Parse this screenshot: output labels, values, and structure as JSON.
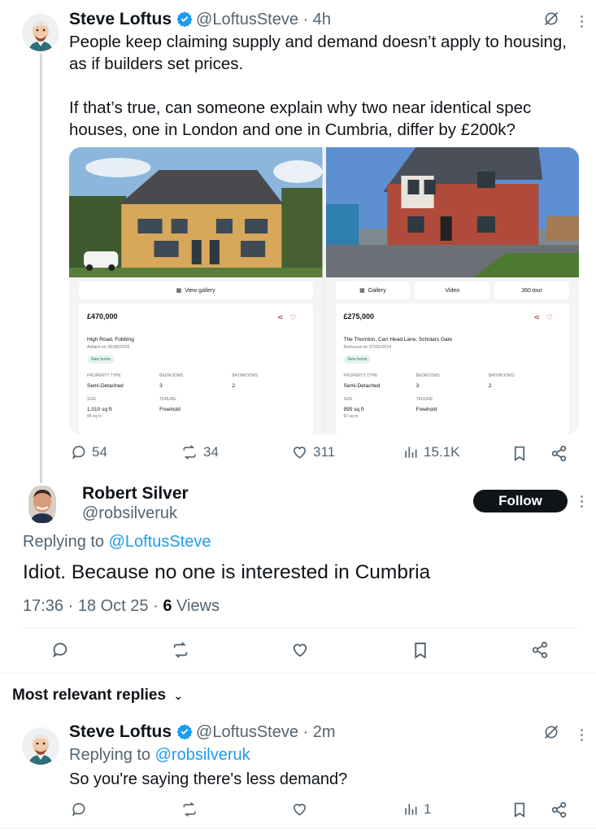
{
  "colors": {
    "accent": "#1d9bf0",
    "text": "#0f1419",
    "muted": "#536471",
    "follow_bg": "#0f1419"
  },
  "post": {
    "author_name": "Steve Loftus",
    "handle_time": "@LoftusSteve · 4h",
    "text_line1": "People keep claiming supply and demand doesn’t apply to housing,",
    "text_line2": "as if builders set prices.",
    "text_line3": "If that’s true, can someone explain why two near identical spec",
    "text_line4": "houses, one in London and one in Cumbria, differ by £200k?",
    "listing_left": {
      "button": "View gallery",
      "price": "£470,000",
      "address": "High Road, Fobbing",
      "added": "Added on 26/08/2025",
      "badge": "New home",
      "property_type_label": "PROPERTY TYPE",
      "property_type": "Semi-Detached",
      "bedrooms_label": "BEDROOMS",
      "bedrooms": "3",
      "bathrooms_label": "BATHROOMS",
      "bathrooms": "2",
      "size_label": "SIZE",
      "size": "1,010 sq ft",
      "size_sub": "94 sq m",
      "tenure_label": "TENURE",
      "tenure": "Freehold"
    },
    "listing_right": {
      "tab1": "Gallery",
      "tab2": "Video",
      "tab3": "360 tour",
      "price": "£275,000",
      "address": "The Thornton, Carr Head Lane, Scholars Gate",
      "added": "Reduced on 07/05/2024",
      "badge": "New home",
      "property_type_label": "PROPERTY TYPE",
      "property_type": "Semi-Detached",
      "bedrooms_label": "BEDROOMS",
      "bedrooms": "3",
      "bathrooms_label": "BATHROOMS",
      "bathrooms": "2",
      "size_label": "SIZE",
      "size": "995 sq ft",
      "size_sub": "92 sq m",
      "tenure_label": "TENURE",
      "tenure": "Freehold"
    },
    "replies": "54",
    "reposts": "34",
    "likes": "311",
    "views": "15.1K"
  },
  "reply": {
    "author_name": "Robert Silver",
    "handle": "@robsilveruk",
    "follow_label": "Follow",
    "replying_prefix": "Replying to ",
    "replying_to": "@LoftusSteve",
    "text": "Idiot. Because no one is interested in Cumbria",
    "meta": "17:36 · 18 Oct 25 · ",
    "views_count": "6",
    "views_label": " Views"
  },
  "section": {
    "label": "Most relevant replies"
  },
  "reply2": {
    "author_name": "Steve Loftus",
    "handle_time": "@LoftusSteve · 2m",
    "replying_prefix": "Replying to ",
    "replying_to": "@robsilveruk",
    "text": "So you're saying there's less demand?",
    "views": "1"
  }
}
